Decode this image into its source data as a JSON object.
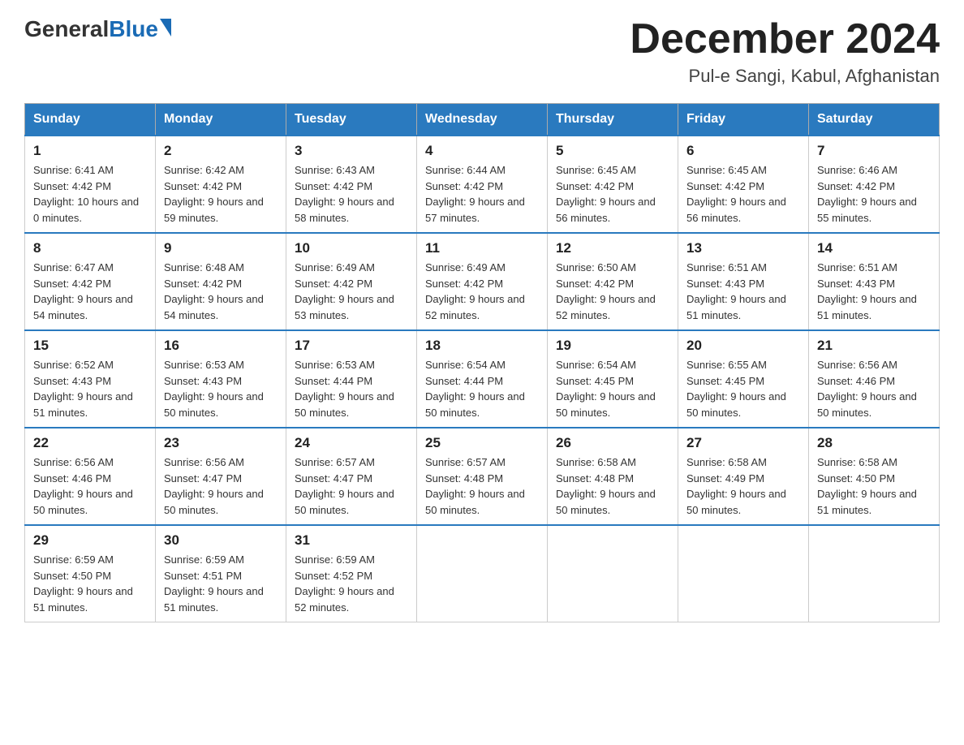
{
  "header": {
    "logo": {
      "general": "General",
      "blue": "Blue"
    },
    "title": "December 2024",
    "subtitle": "Pul-e Sangi, Kabul, Afghanistan"
  },
  "days_of_week": [
    "Sunday",
    "Monday",
    "Tuesday",
    "Wednesday",
    "Thursday",
    "Friday",
    "Saturday"
  ],
  "weeks": [
    [
      {
        "day": "1",
        "sunrise": "6:41 AM",
        "sunset": "4:42 PM",
        "daylight": "10 hours and 0 minutes."
      },
      {
        "day": "2",
        "sunrise": "6:42 AM",
        "sunset": "4:42 PM",
        "daylight": "9 hours and 59 minutes."
      },
      {
        "day": "3",
        "sunrise": "6:43 AM",
        "sunset": "4:42 PM",
        "daylight": "9 hours and 58 minutes."
      },
      {
        "day": "4",
        "sunrise": "6:44 AM",
        "sunset": "4:42 PM",
        "daylight": "9 hours and 57 minutes."
      },
      {
        "day": "5",
        "sunrise": "6:45 AM",
        "sunset": "4:42 PM",
        "daylight": "9 hours and 56 minutes."
      },
      {
        "day": "6",
        "sunrise": "6:45 AM",
        "sunset": "4:42 PM",
        "daylight": "9 hours and 56 minutes."
      },
      {
        "day": "7",
        "sunrise": "6:46 AM",
        "sunset": "4:42 PM",
        "daylight": "9 hours and 55 minutes."
      }
    ],
    [
      {
        "day": "8",
        "sunrise": "6:47 AM",
        "sunset": "4:42 PM",
        "daylight": "9 hours and 54 minutes."
      },
      {
        "day": "9",
        "sunrise": "6:48 AM",
        "sunset": "4:42 PM",
        "daylight": "9 hours and 54 minutes."
      },
      {
        "day": "10",
        "sunrise": "6:49 AM",
        "sunset": "4:42 PM",
        "daylight": "9 hours and 53 minutes."
      },
      {
        "day": "11",
        "sunrise": "6:49 AM",
        "sunset": "4:42 PM",
        "daylight": "9 hours and 52 minutes."
      },
      {
        "day": "12",
        "sunrise": "6:50 AM",
        "sunset": "4:42 PM",
        "daylight": "9 hours and 52 minutes."
      },
      {
        "day": "13",
        "sunrise": "6:51 AM",
        "sunset": "4:43 PM",
        "daylight": "9 hours and 51 minutes."
      },
      {
        "day": "14",
        "sunrise": "6:51 AM",
        "sunset": "4:43 PM",
        "daylight": "9 hours and 51 minutes."
      }
    ],
    [
      {
        "day": "15",
        "sunrise": "6:52 AM",
        "sunset": "4:43 PM",
        "daylight": "9 hours and 51 minutes."
      },
      {
        "day": "16",
        "sunrise": "6:53 AM",
        "sunset": "4:43 PM",
        "daylight": "9 hours and 50 minutes."
      },
      {
        "day": "17",
        "sunrise": "6:53 AM",
        "sunset": "4:44 PM",
        "daylight": "9 hours and 50 minutes."
      },
      {
        "day": "18",
        "sunrise": "6:54 AM",
        "sunset": "4:44 PM",
        "daylight": "9 hours and 50 minutes."
      },
      {
        "day": "19",
        "sunrise": "6:54 AM",
        "sunset": "4:45 PM",
        "daylight": "9 hours and 50 minutes."
      },
      {
        "day": "20",
        "sunrise": "6:55 AM",
        "sunset": "4:45 PM",
        "daylight": "9 hours and 50 minutes."
      },
      {
        "day": "21",
        "sunrise": "6:56 AM",
        "sunset": "4:46 PM",
        "daylight": "9 hours and 50 minutes."
      }
    ],
    [
      {
        "day": "22",
        "sunrise": "6:56 AM",
        "sunset": "4:46 PM",
        "daylight": "9 hours and 50 minutes."
      },
      {
        "day": "23",
        "sunrise": "6:56 AM",
        "sunset": "4:47 PM",
        "daylight": "9 hours and 50 minutes."
      },
      {
        "day": "24",
        "sunrise": "6:57 AM",
        "sunset": "4:47 PM",
        "daylight": "9 hours and 50 minutes."
      },
      {
        "day": "25",
        "sunrise": "6:57 AM",
        "sunset": "4:48 PM",
        "daylight": "9 hours and 50 minutes."
      },
      {
        "day": "26",
        "sunrise": "6:58 AM",
        "sunset": "4:48 PM",
        "daylight": "9 hours and 50 minutes."
      },
      {
        "day": "27",
        "sunrise": "6:58 AM",
        "sunset": "4:49 PM",
        "daylight": "9 hours and 50 minutes."
      },
      {
        "day": "28",
        "sunrise": "6:58 AM",
        "sunset": "4:50 PM",
        "daylight": "9 hours and 51 minutes."
      }
    ],
    [
      {
        "day": "29",
        "sunrise": "6:59 AM",
        "sunset": "4:50 PM",
        "daylight": "9 hours and 51 minutes."
      },
      {
        "day": "30",
        "sunrise": "6:59 AM",
        "sunset": "4:51 PM",
        "daylight": "9 hours and 51 minutes."
      },
      {
        "day": "31",
        "sunrise": "6:59 AM",
        "sunset": "4:52 PM",
        "daylight": "9 hours and 52 minutes."
      },
      null,
      null,
      null,
      null
    ]
  ]
}
